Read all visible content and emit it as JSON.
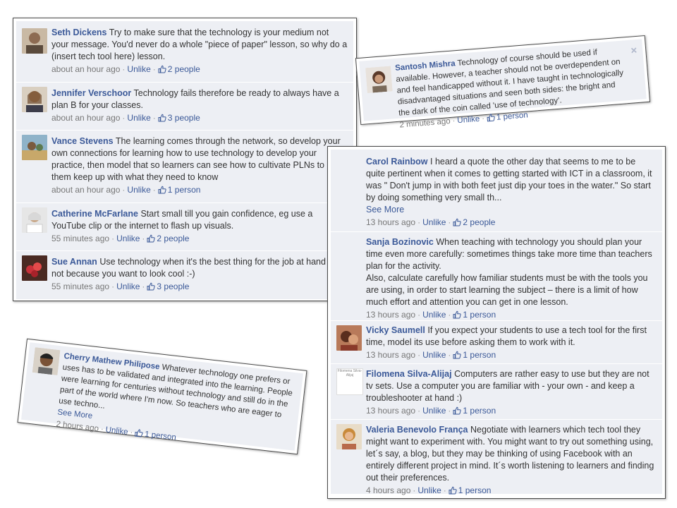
{
  "colors": {
    "name_link": "#3b5998",
    "comment_bg": "#edeff4",
    "meta": "#777777"
  },
  "icons": {
    "like": "thumbs-up-icon",
    "close": "close-icon"
  },
  "sep": "·",
  "panel1": {
    "comments": [
      {
        "name": "Seth Dickens",
        "text": "Try to make sure that the technology is your medium not your message. You'd never do a whole \"piece of paper\" lesson, so why do a (insert tech tool here) lesson.",
        "time": "about an hour ago",
        "action": "Unlike",
        "likes": "2 people"
      },
      {
        "name": "Jennifer Verschoor",
        "text": "Technology fails therefore be ready to always have a plan B for your classes.",
        "time": "about an hour ago",
        "action": "Unlike",
        "likes": "3 people"
      },
      {
        "name": "Vance Stevens",
        "text": "The learning comes through the network, so develop your own connections for learning how to use technology to develop your practice, then model that so learners can see how to cultivate PLNs to help them keep up with what they need to know",
        "time": "about an hour ago",
        "action": "Unlike",
        "likes": "1 person"
      },
      {
        "name": "Catherine McFarlane",
        "text": "Start small till you gain confidence, eg use a YouTube clip or the internet to flash up visuals.",
        "time": "55 minutes ago",
        "action": "Unlike",
        "likes": "2 people"
      },
      {
        "name": "Sue Annan",
        "text": "Use technology when it's the best thing for the job at hand and not because you want to look cool :-)",
        "time": "55 minutes ago",
        "action": "Unlike",
        "likes": "3 people"
      }
    ]
  },
  "panel2": {
    "comment": {
      "name": "Santosh Mishra",
      "text": "Technology of course should be used if available. However, a teacher should not be overdependent on and feel handicapped without it. I have taught in technologically disadvantaged situations and seen both sides: the bright and the dark of the coin called 'use of technology'.",
      "time": "2 minutes ago",
      "action": "Unlike",
      "likes": "1 person"
    },
    "close_label": "×"
  },
  "panel3": {
    "comment": {
      "name": "Cherry Mathew Philipose",
      "text": "Whatever technology one prefers or uses has to be validated and integrated into the learning. People were learning for centuries without technology and still do in the part of the world where I'm now. So teachers who are eager to use techno...",
      "see_more": "See More",
      "time": "2 hours ago",
      "action": "Unlike",
      "likes": "1 person"
    }
  },
  "panel4": {
    "avatar_caption": "Filomena Silva-Alijaj",
    "comments": [
      {
        "name": "Carol Rainbow",
        "text": "I heard a quote the other day that seems to me to be quite pertinent when it comes to getting started with ICT in a classroom, it was \" Don't jump in with both feet just dip your toes in the water.\" So start by doing something very small th...",
        "see_more": "See More",
        "time": "13 hours ago",
        "action": "Unlike",
        "likes": "2 people"
      },
      {
        "name": "Sanja Bozinovic",
        "text": "When teaching with technology you should plan your time even more carefully: sometimes things take more time than teachers plan for the activity.",
        "text2": "Also, calculate carefully how familiar students must be with the tools you are using, in order to start learning the subject – there is a limit of how much effort and attention you can get in one lesson.",
        "time": "13 hours ago",
        "action": "Unlike",
        "likes": "1 person"
      },
      {
        "name": "Vicky Saumell",
        "text": "If you expect your students to use a tech tool for the first time, model its use before asking them to work with it.",
        "time": "13 hours ago",
        "action": "Unlike",
        "likes": "1 person"
      },
      {
        "name": "Filomena Silva-Alijaj",
        "text": "Computers are rather easy to use but they are not tv sets. Use a computer you are familiar with - your own - and keep a troubleshooter at hand :)",
        "time": "13 hours ago",
        "action": "Unlike",
        "likes": "1 person"
      },
      {
        "name": "Valeria Benevolo França",
        "text": "Negotiate with learners which tech tool they might want to experiment with. You might want to try out something using, let´s say, a blog, but they may be thinking of using Facebook with an entirely different project in mind. It´s worth listening to learners and finding out their preferences.",
        "time": "4 hours ago",
        "action": "Unlike",
        "likes": "1 person"
      }
    ]
  }
}
